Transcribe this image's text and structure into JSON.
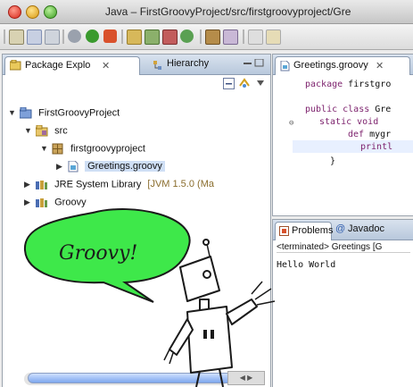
{
  "window": {
    "title": "Java – FirstGroovyProject/src/firstgroovyproject/Gre"
  },
  "left_panel": {
    "tabs": [
      {
        "label": "Package Explo",
        "close": "✕"
      },
      {
        "label": "Hierarchy"
      }
    ],
    "tree": [
      {
        "label": "FirstGroovyProject",
        "expanded": true,
        "icon": "project-icon"
      },
      {
        "label": "src",
        "expanded": true,
        "icon": "source-folder-icon"
      },
      {
        "label": "firstgroovyproject",
        "expanded": true,
        "icon": "package-icon"
      },
      {
        "label": "Greetings.groovy",
        "expanded": false,
        "icon": "groovy-file-icon",
        "selected": true
      },
      {
        "label": "JRE System Library",
        "detail": "[JVM 1.5.0 (Ma",
        "expanded": false,
        "icon": "library-icon"
      },
      {
        "label": "Groovy",
        "expanded": false,
        "icon": "library-icon"
      }
    ]
  },
  "editor": {
    "tab_label": "Greetings.groovy",
    "tab_close": "✕",
    "lines": [
      {
        "kw": "package",
        "text": " firstgro"
      },
      {
        "kw": "public class",
        "text": " Gre"
      },
      {
        "kw": "static void",
        "text": ""
      },
      {
        "kw": "def",
        "text": " mygr"
      },
      {
        "kw": "",
        "text": "printl"
      },
      {
        "kw": "",
        "text": "}"
      }
    ]
  },
  "console": {
    "tabs": [
      {
        "label": "Problems"
      },
      {
        "label": "Javadoc"
      }
    ],
    "status": "<terminated> Greetings [G",
    "output": "Hello World"
  },
  "bubble": {
    "text": "Groovy!"
  },
  "colors": {
    "bubble_fill": "#3ee84a",
    "selection": "#cfdff5",
    "keyword": "#7b1f6b"
  }
}
